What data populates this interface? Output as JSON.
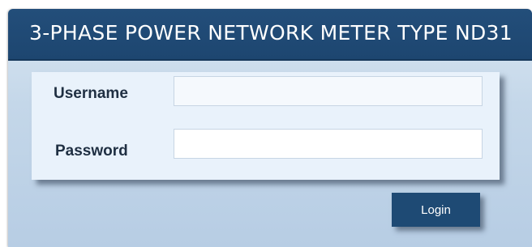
{
  "header": {
    "title": "3-PHASE POWER NETWORK METER TYPE ND31"
  },
  "form": {
    "username_label": "Username",
    "password_label": "Password",
    "username_value": "",
    "password_value": "",
    "login_label": "Login"
  },
  "colors": {
    "header_background": "#1f4a75",
    "panel_background": "#e9f2fb",
    "button_background": "#1e4a74"
  }
}
